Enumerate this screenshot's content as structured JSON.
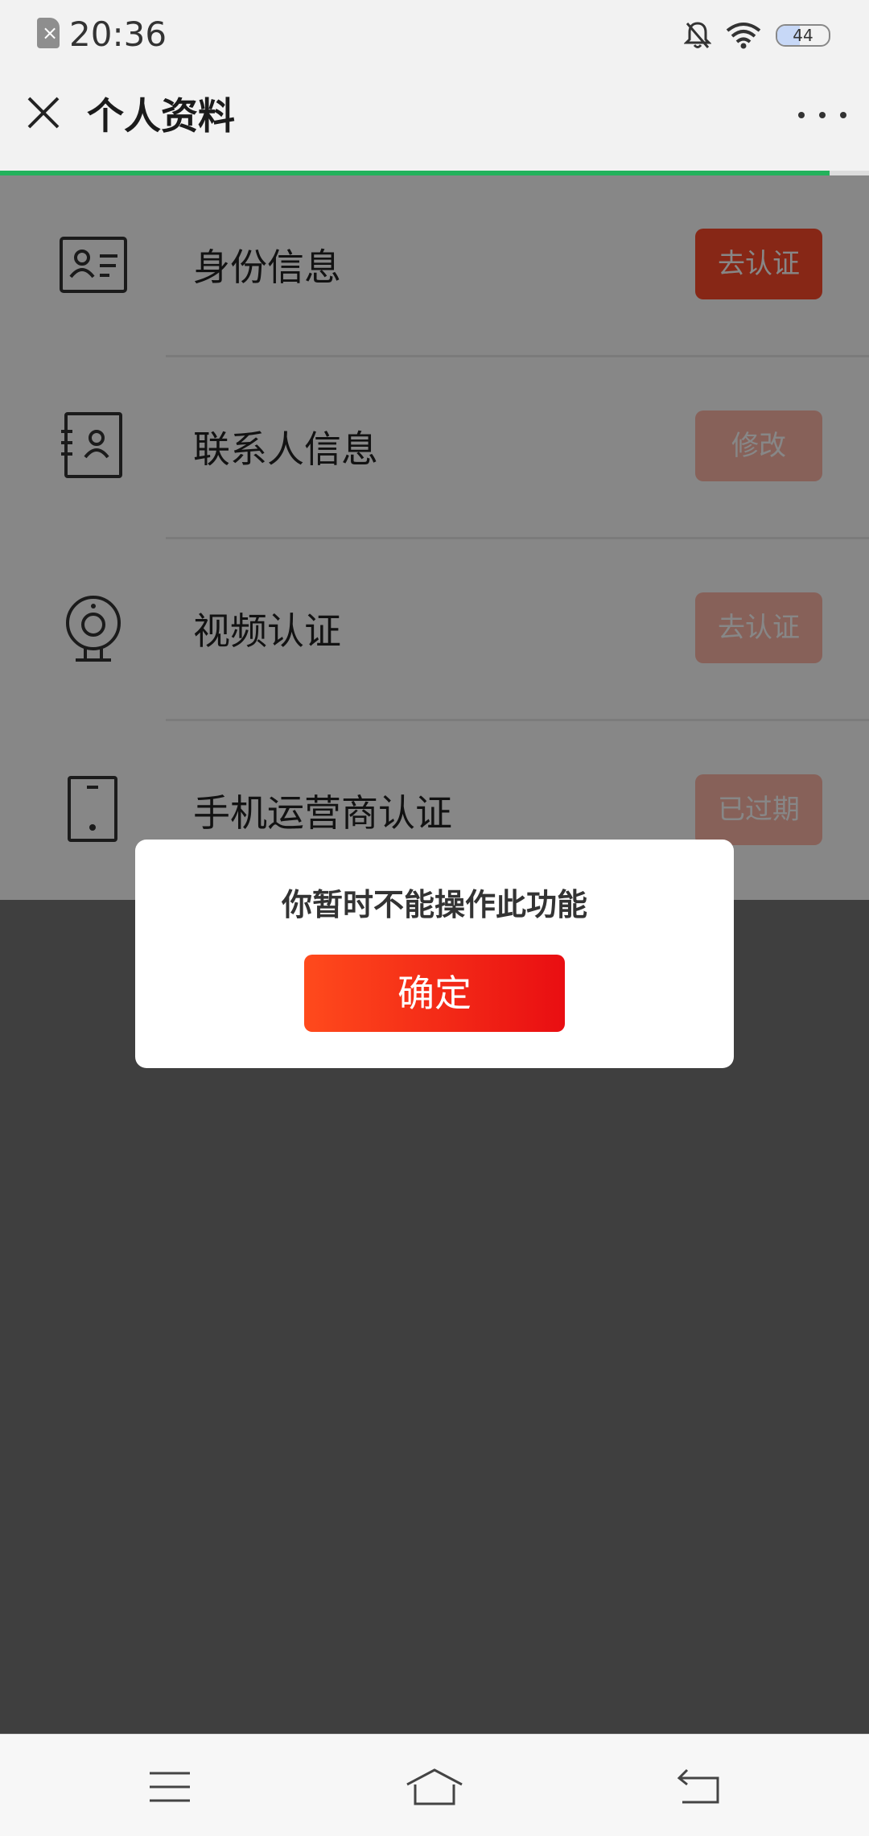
{
  "status_bar": {
    "time": "20:36",
    "battery": "44",
    "battery_level": 0.44
  },
  "header": {
    "title": "个人资料"
  },
  "progress": 0.955,
  "rows": [
    {
      "label": "身份信息",
      "action": "去认证",
      "icon": "id-card-icon"
    },
    {
      "label": "联系人信息",
      "action": "修改",
      "icon": "contact-book-icon"
    },
    {
      "label": "视频认证",
      "action": "去认证",
      "icon": "webcam-icon"
    },
    {
      "label": "手机运营商认证",
      "action": "已过期",
      "icon": "phone-icon"
    }
  ],
  "dialog": {
    "message": "你暂时不能操作此功能",
    "confirm": "确定"
  },
  "colors": {
    "accent": "#ff4a2b",
    "progress": "#23b25c",
    "confirm_from": "#ff4a1c",
    "confirm_to": "#e90e12"
  }
}
